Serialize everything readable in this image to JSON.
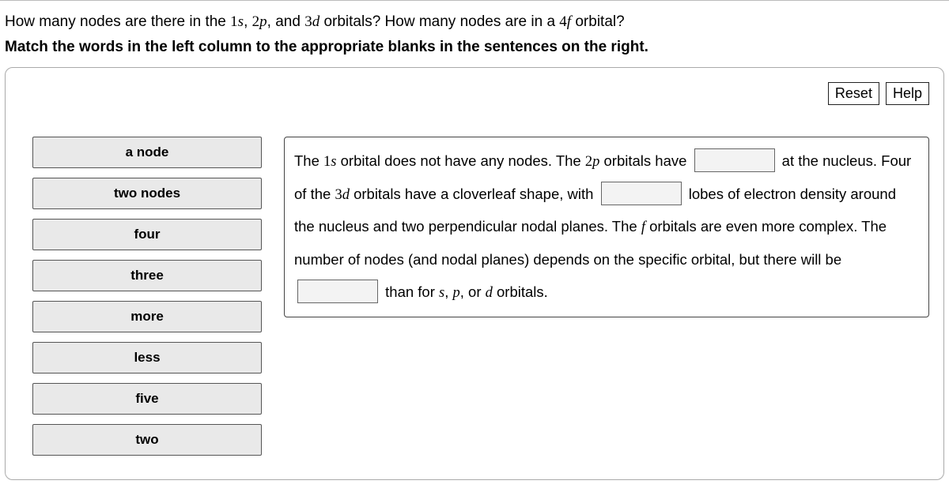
{
  "question": {
    "part1_a": "How many nodes are there in the ",
    "orb1_n": "1",
    "orb1_l": "s",
    "sep1": ", ",
    "orb2_n": "2",
    "orb2_l": "p",
    "sep2": ", and ",
    "orb3_n": "3",
    "orb3_l": "d",
    "part1_b": " orbitals? How many nodes are in a ",
    "orb4_n": "4",
    "orb4_l": "f",
    "part1_c": " orbital?"
  },
  "instruction": "Match the words in the left column to the appropriate blanks in the sentences on the right.",
  "buttons": {
    "reset": "Reset",
    "help": "Help"
  },
  "words": [
    "a node",
    "two nodes",
    "four",
    "three",
    "more",
    "less",
    "five",
    "two"
  ],
  "sentence": {
    "s1_a": "The ",
    "s1_n": "1",
    "s1_l": "s",
    "s1_b": " orbital does not have any nodes. The ",
    "s2_n": "2",
    "s2_l": "p",
    "s2_a": " orbitals have ",
    "s3_a": " at the nucleus. Four of the ",
    "s3_n": "3",
    "s3_l": "d",
    "s3_b": " orbitals have a cloverleaf shape, with ",
    "s4_a": " lobes of electron density around the nucleus and two perpendicular nodal planes. The ",
    "s4_l": "f",
    "s4_b": " orbitals are even more complex. The number of nodes (and nodal planes) depends on the specific orbital, but there will be ",
    "s5_a": " than for ",
    "s5_l1": "s",
    "s5_c1": ", ",
    "s5_l2": "p",
    "s5_c2": ", or ",
    "s5_l3": "d",
    "s5_b": " orbitals."
  }
}
